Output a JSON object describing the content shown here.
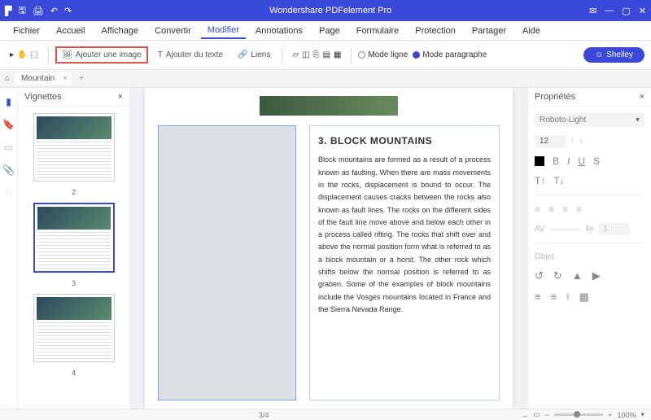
{
  "title_bar": {
    "app_title": "Wondershare PDFelement Pro"
  },
  "menu": {
    "fichier": "Fichier",
    "accueil": "Accueil",
    "affichage": "Affichage",
    "convertir": "Convertir",
    "modifier": "Modifier",
    "annotations": "Annotations",
    "page": "Page",
    "formulaire": "Formulaire",
    "protection": "Protection",
    "partager": "Partager",
    "aide": "Aide"
  },
  "toolbar": {
    "ajouter_image": "Ajouter une image",
    "ajouter_texte": "Ajouter du texte",
    "liens": "Liens",
    "mode_ligne": "Mode ligne",
    "mode_paragraphe": "Mode paragraphe",
    "user": "Shelley"
  },
  "tabs": {
    "doc": "Mountain"
  },
  "thumbs": {
    "title": "Vignettes",
    "p2": "2",
    "p3": "3",
    "p4": "4"
  },
  "doc": {
    "heading": "3. BLOCK MOUNTAINS",
    "body": "Block mountains are formed as a result of a process known as faulting. When there are mass movements in the rocks, displacement is bound to occur. The displacement causes cracks between the rocks also known as fault lines. The rocks on the different sides of the fault line move above and below each other in a process called rifting. The rocks that shift over and above the normal position form what is referred to as a block mountain or a horst. The other rock which shifts below the normal position is referred to as graben. Some of the examples of block mountains include the Vosges mountains located in France and the Sierra Nevada Range."
  },
  "props": {
    "title": "Propriétés",
    "font": "Roboto-Light",
    "size": "12",
    "objet": "Objet",
    "spacing": "1"
  },
  "status": {
    "page": "3",
    "total": "/4",
    "zoom": "100%"
  }
}
